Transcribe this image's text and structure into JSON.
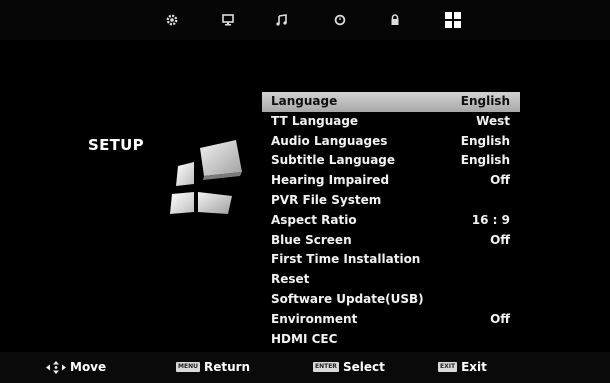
{
  "tabs": [
    {
      "icon": "picture-gear-icon"
    },
    {
      "icon": "channel-monitor-icon"
    },
    {
      "icon": "sound-note-icon"
    },
    {
      "icon": "time-clock-icon"
    },
    {
      "icon": "lock-icon"
    },
    {
      "icon": "setup-grid-icon",
      "active": true
    }
  ],
  "page": {
    "title": "SETUP"
  },
  "menu": [
    {
      "label": "Language",
      "value": "English"
    },
    {
      "label": "TT Language",
      "value": "West"
    },
    {
      "label": "Audio Languages",
      "value": "English"
    },
    {
      "label": "Subtitle Language",
      "value": "English"
    },
    {
      "label": "Hearing Impaired",
      "value": "Off"
    },
    {
      "label": "PVR File System",
      "value": ""
    },
    {
      "label": "Aspect Ratio",
      "value": "16 : 9"
    },
    {
      "label": "Blue Screen",
      "value": "Off"
    },
    {
      "label": "First Time Installation",
      "value": ""
    },
    {
      "label": "Reset",
      "value": ""
    },
    {
      "label": "Software Update(USB)",
      "value": ""
    },
    {
      "label": "Environment",
      "value": "Off"
    },
    {
      "label": "HDMI CEC",
      "value": ""
    }
  ],
  "hints": {
    "move": {
      "label": "Move",
      "icon": "four-way-arrows-icon"
    },
    "return": {
      "key": "MENU",
      "label": "Return"
    },
    "select": {
      "key": "ENTER",
      "label": "Select"
    },
    "exit": {
      "key": "EXIT",
      "label": "Exit"
    }
  },
  "colors": {
    "selected_bg": "#b9b9b9",
    "text": "#f2f2f2",
    "background": "#000000"
  }
}
